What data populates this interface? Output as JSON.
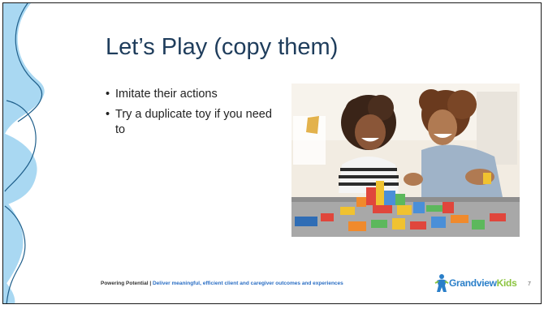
{
  "slide": {
    "title": "Let’s Play (copy them)",
    "bullets": [
      "Imitate their actions",
      "Try a duplicate toy if you need to"
    ],
    "bullet_symbol": "•",
    "photo": {
      "subject": "woman and young girl playing with colorful wooden blocks at a table"
    },
    "footer": {
      "lead": "Powering Potential",
      "separator": " | ",
      "tagline": "Deliver meaningful, efficient client and caregiver outcomes and experiences"
    },
    "logo": {
      "word1": "Grandview",
      "word2": "Kids"
    },
    "page_number": "7"
  },
  "colors": {
    "title": "#1f3d5c",
    "wave": "#a9d8f2",
    "footer_tagline": "#2a6ec4",
    "logo_blue": "#2a7fc9",
    "logo_green": "#8bc43f"
  }
}
